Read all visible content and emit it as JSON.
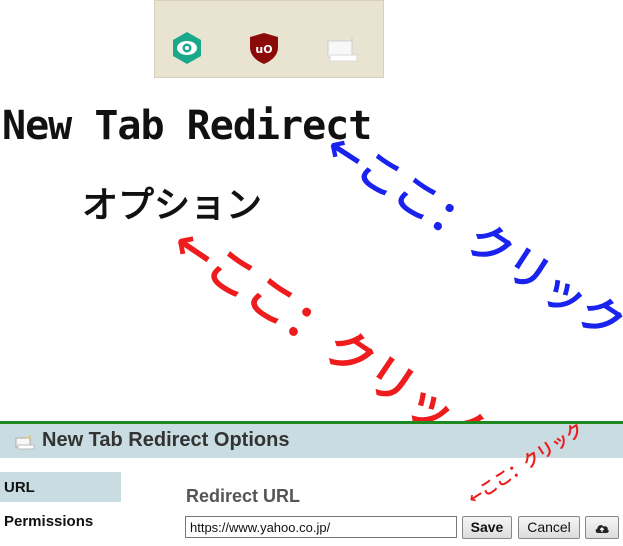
{
  "toolbar": {
    "extensions": [
      {
        "name": "eye-extension",
        "color": "#19a98a"
      },
      {
        "name": "ublock-origin",
        "label": "uO",
        "color": "#8b0a0a"
      },
      {
        "name": "new-tab-redirect",
        "color": "#f4f4f4"
      }
    ]
  },
  "heading": {
    "title": "New Tab Redirect",
    "subtitle": "オプション"
  },
  "annotations": {
    "blue": "←ここ：クリック",
    "red_large": "←ここ：クリック",
    "red_small": "←ここ：クリック"
  },
  "options": {
    "title": "New Tab Redirect Options",
    "nav": [
      "URL",
      "Permissions"
    ],
    "active_nav": "URL",
    "redirect_label": "Redirect URL",
    "url_value": "https://www.yahoo.co.jp/",
    "save_label": "Save",
    "cancel_label": "Cancel",
    "colors": {
      "header_bg": "#c9dce2",
      "top_border": "#1f8a1f"
    }
  }
}
